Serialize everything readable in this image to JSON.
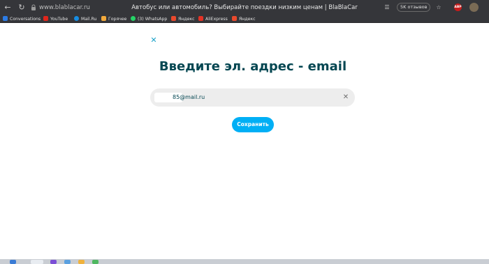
{
  "browser": {
    "url": "www.blablacar.ru",
    "tab_title": "Автобус или автомобиль? Выбирайте поездки низким ценам | BlaBlaCar",
    "reviews_label": "5K отзывов",
    "adblock_label": "ABP",
    "back_icon": "back-arrow-icon",
    "lock_icon": "lock-icon"
  },
  "bookmarks": [
    {
      "label": "Conversations",
      "icon": "chat-icon",
      "color": "#2b7be4"
    },
    {
      "label": "YouTube",
      "icon": "youtube-icon",
      "color": "#e0251b"
    },
    {
      "label": "Mail.Ru",
      "icon": "mailru-icon",
      "color": "#168de2"
    },
    {
      "label": "Горячее",
      "icon": "hot-icon",
      "color": "#f2a93b"
    },
    {
      "label": "(3) WhatsApp",
      "icon": "whatsapp-icon",
      "color": "#25d366"
    },
    {
      "label": "Яндекс",
      "icon": "yandex-icon",
      "color": "#e9492c"
    },
    {
      "label": "AliExpress",
      "icon": "aliexpress-icon",
      "color": "#e43225"
    },
    {
      "label": "Яндекс",
      "icon": "yandex-icon",
      "color": "#e9492c"
    }
  ],
  "page": {
    "heading": "Введите эл. адрес - email",
    "email_value": "85@mail.ru",
    "save_label": "Сохранить",
    "close_icon": "close-icon",
    "clear_icon": "clear-icon"
  },
  "colors": {
    "accent": "#00aff5",
    "heading": "#054752",
    "close": "#1aa1c8"
  }
}
